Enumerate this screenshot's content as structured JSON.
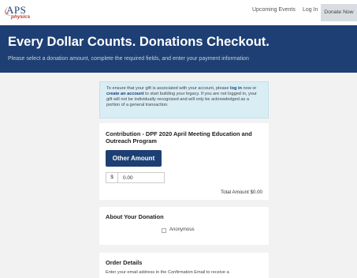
{
  "header": {
    "logo": {
      "aps": "APS",
      "physics": "physics"
    },
    "nav": {
      "events": "Upcoming Events",
      "login": "Log In",
      "donate": "Donate Now"
    }
  },
  "hero": {
    "title": "Every Dollar Counts. Donations Checkout.",
    "subtitle": "Please select a donation amount, complete the required fields, and enter your payment information"
  },
  "info": {
    "part1": "To ensure that your gift is associated with your account, please ",
    "login_link": "log in",
    "part2": " now or ",
    "create_link": "create an account",
    "part3": " to start building your legacy. If you are not logged in, your gift will not be individually recognized and will only be acknowledged as a portion of a general transaction."
  },
  "contribution": {
    "title": "Contribution - DPF 2020 April Meeting Education and Outreach Program",
    "other_amount_label": "Other Amount",
    "currency_symbol": "$",
    "amount_value": "0.00",
    "total_text": "Total Amount $0.00"
  },
  "about": {
    "title": "About Your Donation",
    "anonymous_label": "Anonymous"
  },
  "order": {
    "title": "Order Details",
    "text": "Enter your email address in the Confirmation Email to receive a"
  },
  "colors": {
    "brand": "#1e3f73",
    "info_bg": "#d9edf5",
    "page_bg": "#f2f2f2"
  },
  "icons": [
    "aps-logo",
    "checkbox-icon"
  ]
}
